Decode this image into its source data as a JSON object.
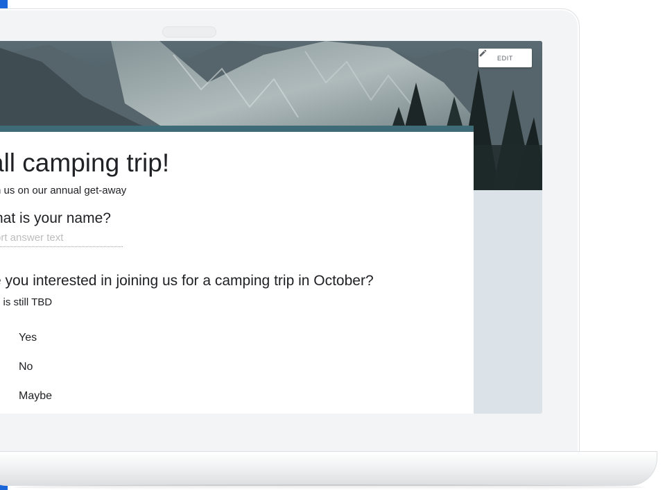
{
  "colors": {
    "theme_accent": "#3f6b77",
    "side_panel": "#dce3e8",
    "left_stripe": "#1a66d9"
  },
  "header": {
    "edit_icon": "pencil-icon",
    "edit_label": "EDIT"
  },
  "form": {
    "title": "all camping trip!",
    "description": "n us on our annual get-away"
  },
  "questions": [
    {
      "title": "hat is your name?",
      "placeholder": "ort answer text"
    },
    {
      "title": "e you interested in joining us for a camping trip in October?",
      "description": "e is still TBD",
      "options": [
        "Yes",
        "No",
        "Maybe"
      ]
    }
  ]
}
